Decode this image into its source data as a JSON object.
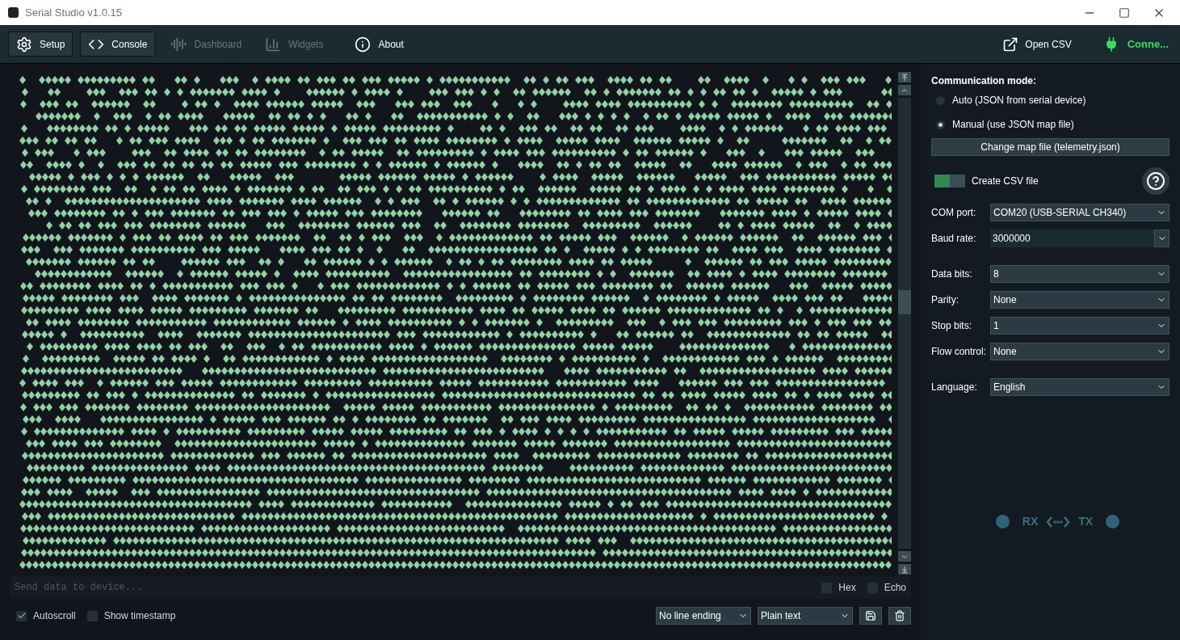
{
  "window": {
    "title": "Serial Studio v1.0.15"
  },
  "toolbar": {
    "tabs": [
      {
        "label": "Setup",
        "kind": "gear",
        "active": true,
        "disabled": false
      },
      {
        "label": "Console",
        "kind": "code",
        "active": true,
        "disabled": false
      },
      {
        "label": "Dashboard",
        "kind": "wave",
        "active": false,
        "disabled": true
      },
      {
        "label": "Widgets",
        "kind": "bars",
        "active": false,
        "disabled": true
      },
      {
        "label": "About",
        "kind": "info",
        "active": false,
        "disabled": false
      }
    ],
    "open_csv": "Open CSV",
    "connection": "Conne..."
  },
  "console": {
    "send_placeholder": "Send data to device...",
    "send_options": [
      {
        "label": "Hex",
        "checked": false
      },
      {
        "label": "Echo",
        "checked": false
      }
    ],
    "options": [
      {
        "label": "Autoscroll",
        "checked": true
      },
      {
        "label": "Show timestamp",
        "checked": false
      }
    ],
    "line_ending": "No line ending",
    "display_mode": "Plain text"
  },
  "setup": {
    "communication_mode": "Communication mode:",
    "modes": [
      {
        "label": "Auto (JSON from serial device)",
        "selected": false
      },
      {
        "label": "Manual (use JSON map file)",
        "selected": true
      }
    ],
    "change_map_button": "Change map file (telemetry.json)",
    "create_csv": {
      "label": "Create CSV file",
      "on": true
    },
    "field_groups": [
      [
        {
          "label": "COM port:",
          "value": "COM20 (USB-SERIAL CH340)",
          "kind": "select"
        },
        {
          "label": "Baud rate:",
          "value": "3000000",
          "kind": "combo"
        }
      ],
      [
        {
          "label": "Data bits:",
          "value": "8",
          "kind": "select"
        },
        {
          "label": "Parity:",
          "value": "None",
          "kind": "select"
        },
        {
          "label": "Stop bits:",
          "value": "1",
          "kind": "select"
        },
        {
          "label": "Flow control:",
          "value": "None",
          "kind": "select"
        }
      ],
      [
        {
          "label": "Language:",
          "value": "English",
          "kind": "select"
        }
      ]
    ],
    "rx": "RX",
    "tx": "TX"
  }
}
